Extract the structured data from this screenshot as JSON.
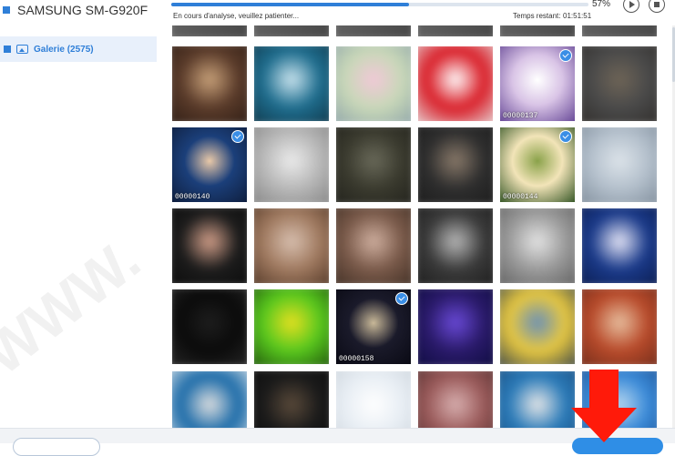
{
  "device": {
    "name": "SAMSUNG SM-G920F"
  },
  "sidebar": {
    "items": [
      {
        "label": "Galerie (2575)"
      }
    ]
  },
  "progress": {
    "percent_label": "57%",
    "fraction": 0.57,
    "status": "En cours d'analyse, veuillez patienter...",
    "time_label": "Temps restant:",
    "time_value": "01:51:51"
  },
  "controls": {
    "play_icon": "play-icon",
    "stop_icon": "stop-icon"
  },
  "gallery": {
    "tiles": [
      {
        "label": "",
        "selected": false,
        "sharp": false
      },
      {
        "label": "",
        "selected": false,
        "sharp": false
      },
      {
        "label": "",
        "selected": false,
        "sharp": false
      },
      {
        "label": "",
        "selected": false,
        "sharp": false
      },
      {
        "label": "00000137",
        "selected": true,
        "sharp": true
      },
      {
        "label": "",
        "selected": false,
        "sharp": false
      },
      {
        "label": "00000140",
        "selected": true,
        "sharp": true
      },
      {
        "label": "",
        "selected": false,
        "sharp": false
      },
      {
        "label": "",
        "selected": false,
        "sharp": false
      },
      {
        "label": "",
        "selected": false,
        "sharp": false
      },
      {
        "label": "00000144",
        "selected": true,
        "sharp": true
      },
      {
        "label": "",
        "selected": false,
        "sharp": false
      },
      {
        "label": "",
        "selected": false,
        "sharp": false
      },
      {
        "label": "",
        "selected": false,
        "sharp": false
      },
      {
        "label": "",
        "selected": false,
        "sharp": false
      },
      {
        "label": "",
        "selected": false,
        "sharp": false
      },
      {
        "label": "",
        "selected": false,
        "sharp": false
      },
      {
        "label": "",
        "selected": false,
        "sharp": false
      },
      {
        "label": "",
        "selected": false,
        "sharp": false
      },
      {
        "label": "",
        "selected": false,
        "sharp": false
      },
      {
        "label": "00000158",
        "selected": true,
        "sharp": true
      },
      {
        "label": "",
        "selected": false,
        "sharp": false
      },
      {
        "label": "",
        "selected": false,
        "sharp": false
      },
      {
        "label": "",
        "selected": false,
        "sharp": false
      },
      {
        "label": "",
        "selected": false,
        "sharp": false
      },
      {
        "label": "",
        "selected": false,
        "sharp": false
      },
      {
        "label": "",
        "selected": false,
        "sharp": false
      },
      {
        "label": "",
        "selected": false,
        "sharp": false
      },
      {
        "label": "",
        "selected": false,
        "sharp": false
      },
      {
        "label": "",
        "selected": false,
        "sharp": false
      }
    ]
  },
  "colors": {
    "accent": "#2f7fd8",
    "arrow": "#ff1a0a",
    "badge": "#3a8ee6"
  }
}
